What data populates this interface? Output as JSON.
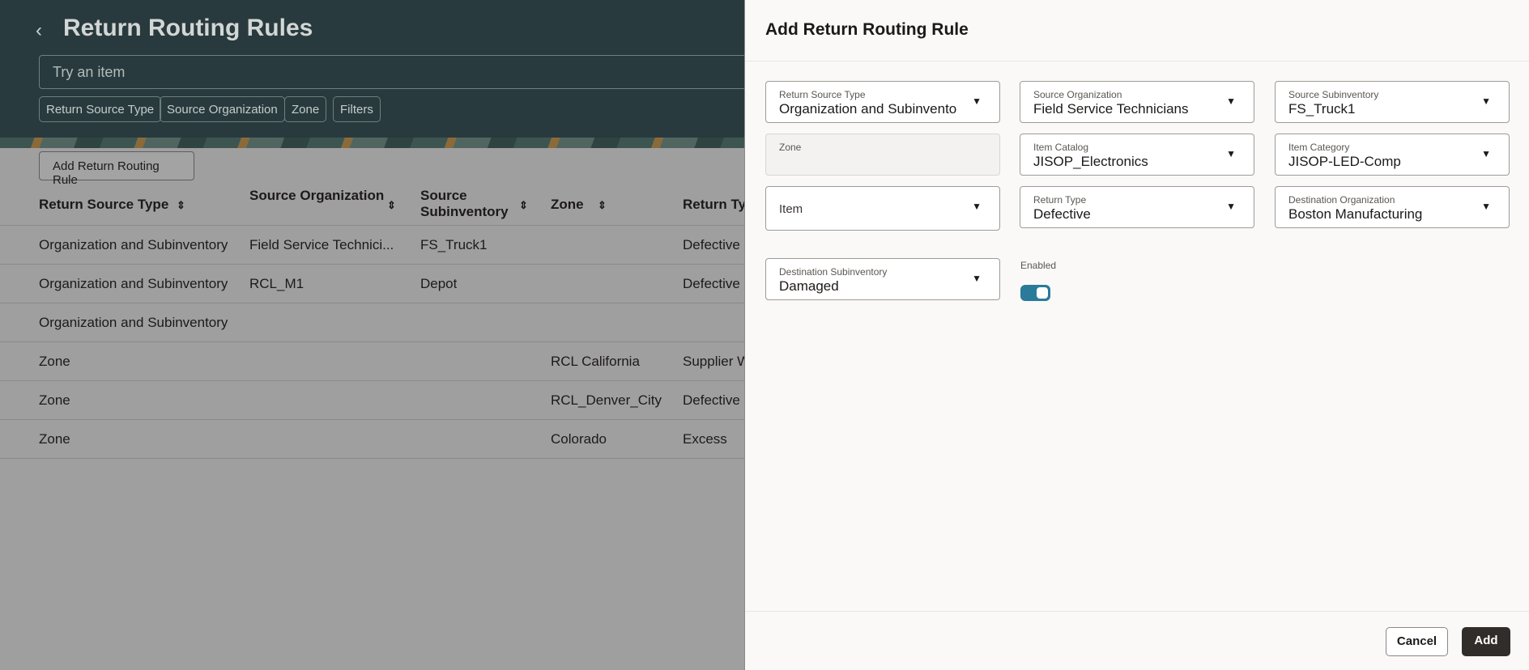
{
  "page": {
    "title": "Return Routing Rules",
    "search_placeholder": "Try an item",
    "chips": [
      "Return Source Type",
      "Source Organization",
      "Zone",
      "Filters"
    ],
    "add_button": "Add Return Routing Rule",
    "columns": [
      "Return Source Type",
      "Source Organization",
      "Source Subinventory",
      "Zone",
      "Return Typ"
    ],
    "rows": [
      [
        "Organization and Subinventory",
        "Field Service Technici...",
        "FS_Truck1",
        "",
        "Defective"
      ],
      [
        "Organization and Subinventory",
        "RCL_M1",
        "Depot",
        "",
        "Defective"
      ],
      [
        "Organization and Subinventory",
        "",
        "",
        "",
        ""
      ],
      [
        "Zone",
        "",
        "",
        "RCL California",
        "Supplier W"
      ],
      [
        "Zone",
        "",
        "",
        "RCL_Denver_City",
        "Defective"
      ],
      [
        "Zone",
        "",
        "",
        "Colorado",
        "Excess"
      ]
    ]
  },
  "drawer": {
    "title": "Add Return Routing Rule",
    "fields": [
      {
        "label": "Return Source Type",
        "value": "Organization and Subinventory"
      },
      {
        "label": "Source Organization",
        "value": "Field Service Technicians"
      },
      {
        "label": "Source Subinventory",
        "value": "FS_Truck1"
      },
      {
        "label": "Zone",
        "value": ""
      },
      {
        "label": "Item Catalog",
        "value": "JISOP_Electronics"
      },
      {
        "label": "Item Category",
        "value": "JISOP-LED-Comp"
      },
      {
        "label": "Item",
        "value": ""
      },
      {
        "label": "Return Type",
        "value": "Defective"
      },
      {
        "label": "Destination Organization",
        "value": "Boston Manufacturing"
      },
      {
        "label": "Destination Subinventory",
        "value": "Damaged"
      }
    ],
    "enabled_label": "Enabled",
    "enabled": true,
    "cancel": "Cancel",
    "add": "Add"
  }
}
